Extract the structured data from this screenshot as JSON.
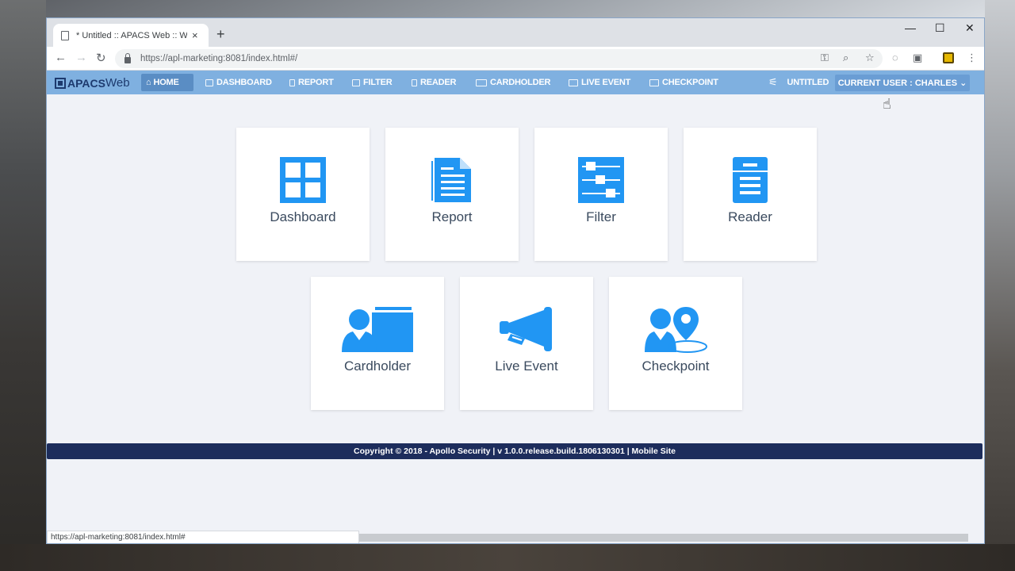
{
  "browser": {
    "tab_title": "* Untitled :: APACS Web :: Welcome",
    "tab_close": "×",
    "new_tab": "+",
    "url": "https://apl-marketing:8081/index.html#/",
    "status_url": "https://apl-marketing:8081/index.html#",
    "window_controls": {
      "minimize": "—",
      "maximize": "☐",
      "close": "✕"
    }
  },
  "app": {
    "logo": {
      "brand": "APACS",
      "suffix": "Web"
    },
    "nav": [
      {
        "label": "HOME",
        "icon": "home-icon"
      },
      {
        "label": "DASHBOARD",
        "icon": "dashboard-icon"
      },
      {
        "label": "REPORT",
        "icon": "report-icon"
      },
      {
        "label": "FILTER",
        "icon": "filter-icon"
      },
      {
        "label": "READER",
        "icon": "reader-icon"
      },
      {
        "label": "CARDHOLDER",
        "icon": "cardholder-icon"
      },
      {
        "label": "LIVE EVENT",
        "icon": "live-event-icon"
      },
      {
        "label": "CHECKPOINT",
        "icon": "checkpoint-icon"
      }
    ],
    "untitled_label": "UNTITLED",
    "current_user": "CURRENT USER : CHARLES ⌄"
  },
  "tiles": [
    {
      "label": "Dashboard",
      "icon": "dashboard-icon"
    },
    {
      "label": "Report",
      "icon": "report-icon"
    },
    {
      "label": "Filter",
      "icon": "filter-icon"
    },
    {
      "label": "Reader",
      "icon": "reader-icon"
    },
    {
      "label": "Cardholder",
      "icon": "cardholder-icon"
    },
    {
      "label": "Live Event",
      "icon": "live-event-icon"
    },
    {
      "label": "Checkpoint",
      "icon": "checkpoint-icon"
    }
  ],
  "footer": {
    "text": "Copyright © 2018 - Apollo Security | v 1.0.0.release.build.1806130301 | Mobile Site"
  },
  "colors": {
    "accent": "#2196f3",
    "navbar": "#7fb0e0",
    "footer": "#1d2d5c",
    "active_nav": "#5a8dc4"
  }
}
